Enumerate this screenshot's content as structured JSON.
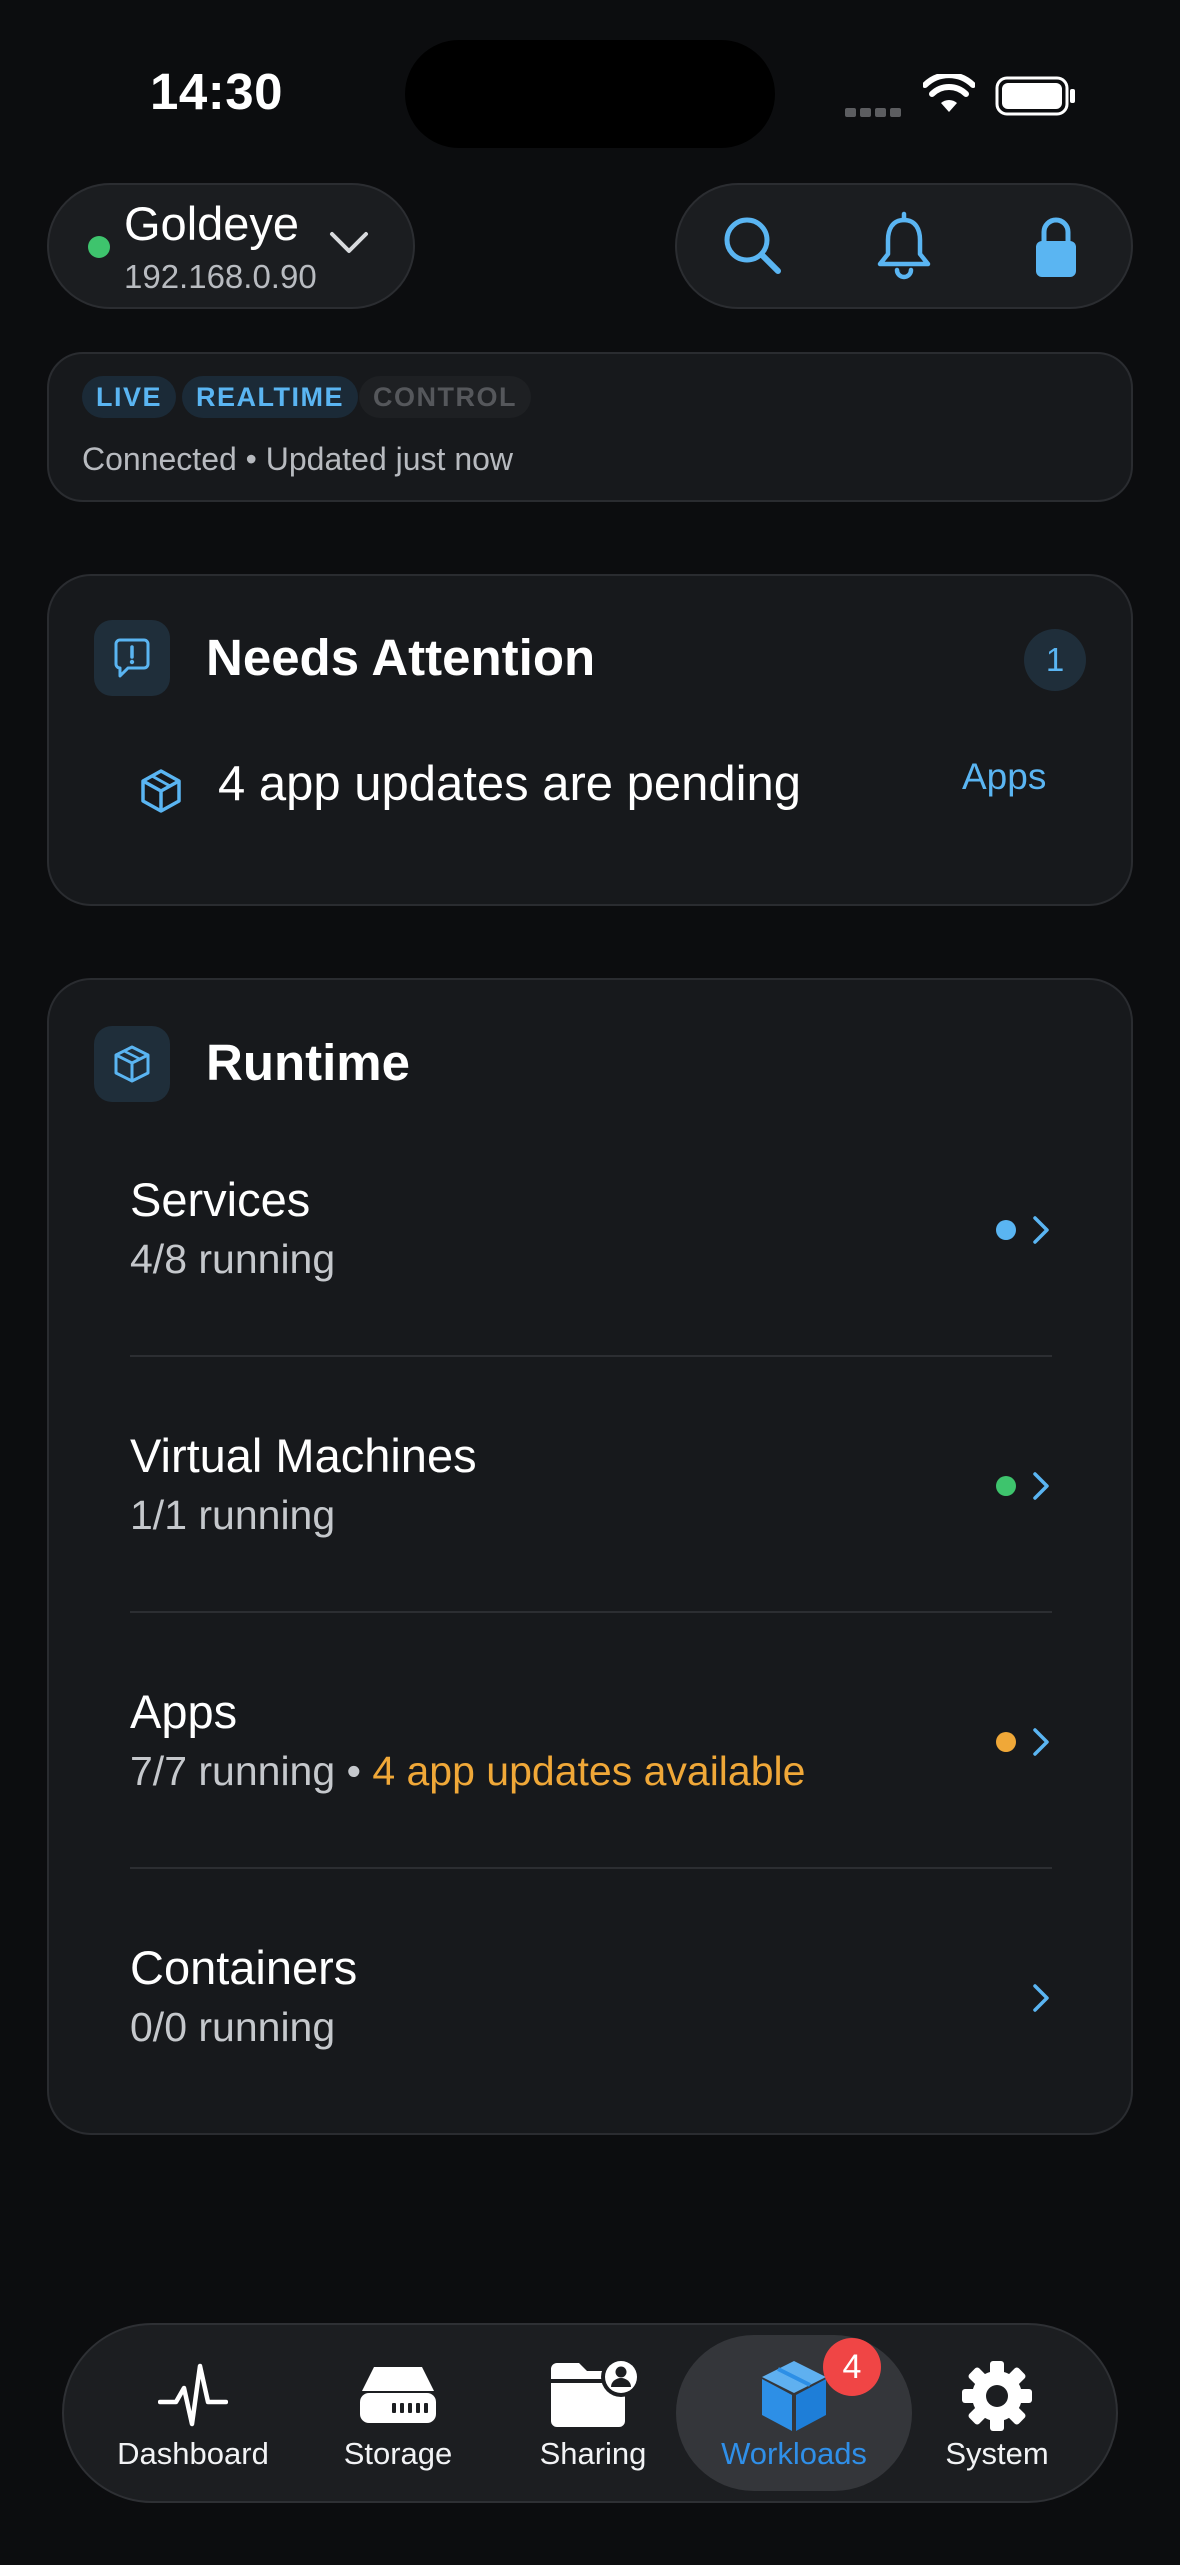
{
  "status_bar": {
    "time": "14:30"
  },
  "header": {
    "server_name": "Goldeye",
    "server_ip": "192.168.0.90",
    "status_color": "#3ec46d",
    "actions": [
      "search-icon",
      "bell-icon",
      "lock-icon"
    ]
  },
  "connection": {
    "chips": [
      "LIVE",
      "REALTIME",
      "CONTROL"
    ],
    "status_text": "Connected • Updated just now"
  },
  "attention": {
    "title": "Needs Attention",
    "count": "1",
    "item_text": "4 app updates are pending",
    "item_link": "Apps"
  },
  "runtime": {
    "title": "Runtime",
    "rows": [
      {
        "title": "Services",
        "sub": "4/8 running",
        "dot_color": "#5ab5f2"
      },
      {
        "title": "Virtual Machines",
        "sub": "1/1 running",
        "dot_color": "#3ec46d"
      },
      {
        "title": "Apps",
        "sub": "7/7 running",
        "sub_sep": " • ",
        "sub_warn": "4 app updates available",
        "dot_color": "#f0a838"
      },
      {
        "title": "Containers",
        "sub": "0/0 running",
        "dot_color": ""
      }
    ]
  },
  "tabbar": {
    "tabs": [
      {
        "label": "Dashboard",
        "icon": "pulse-icon"
      },
      {
        "label": "Storage",
        "icon": "drive-icon"
      },
      {
        "label": "Sharing",
        "icon": "shared-folder-icon"
      },
      {
        "label": "Workloads",
        "icon": "cube-icon",
        "badge": "4",
        "active": true
      },
      {
        "label": "System",
        "icon": "gear-icon"
      }
    ]
  },
  "colors": {
    "accent": "#5ab5f2",
    "warning": "#f0a838",
    "success": "#3ec46d",
    "badge": "#f04545"
  }
}
